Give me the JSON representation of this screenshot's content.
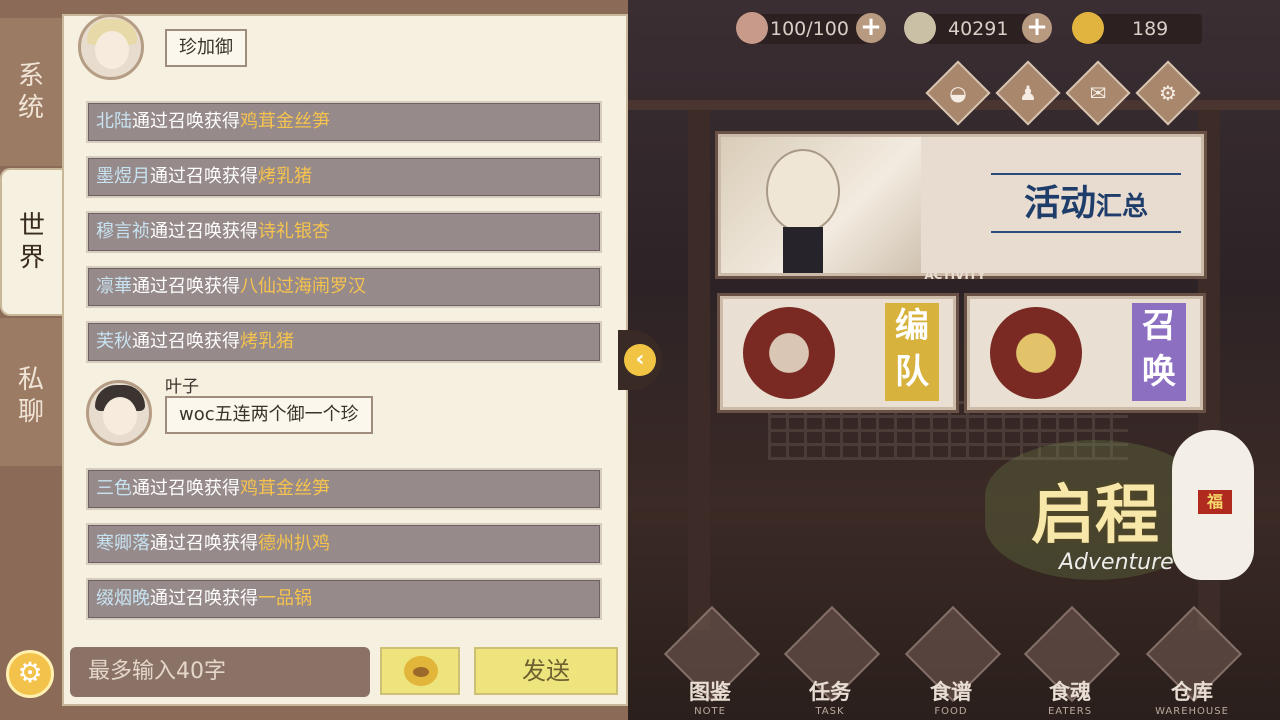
{
  "resources": {
    "stamina": "100/100",
    "coins": "40291",
    "gems": "189"
  },
  "tabs": [
    {
      "label_top": "系",
      "label_bottom": "统"
    },
    {
      "label_top": "世",
      "label_bottom": "界"
    },
    {
      "label_top": "私",
      "label_bottom": "聊"
    }
  ],
  "chat": {
    "first_bubble": "珍加御",
    "messages": [
      {
        "name": "北陆",
        "verb": "通过召唤获得",
        "item": "鸡茸金丝笋"
      },
      {
        "name": "墨煜月",
        "verb": "通过召唤获得",
        "item": "烤乳猪"
      },
      {
        "name": "穆言祯",
        "verb": "通过召唤获得",
        "item": "诗礼银杏"
      },
      {
        "name": "凛華",
        "verb": "通过召唤获得",
        "item": "八仙过海闹罗汉"
      },
      {
        "name": "芙秋",
        "verb": "通过召唤获得",
        "item": "烤乳猪"
      },
      {
        "name": "三色",
        "verb": "通过召唤获得",
        "item": "鸡茸金丝笋"
      },
      {
        "name": "寒卿落",
        "verb": "通过召唤获得",
        "item": "德州扒鸡"
      },
      {
        "name": "缀烟晚",
        "verb": "通过召唤获得",
        "item": "一品锅"
      }
    ],
    "user_msg": {
      "name": "叶子",
      "text": "woc五连两个御一个珍"
    },
    "input_placeholder": "最多输入40字",
    "send_label": "发送"
  },
  "banner": {
    "title_big": "活动",
    "title_small": "汇总",
    "label": "ACTIVITY"
  },
  "cards": [
    {
      "label": "编队"
    },
    {
      "label": "召唤"
    }
  ],
  "adventure": {
    "cn": "启程",
    "en": "Adventure",
    "tag": "福"
  },
  "bottom_nav": [
    {
      "cn": "图鉴",
      "en": "NOTE"
    },
    {
      "cn": "任务",
      "en": "TASK"
    },
    {
      "cn": "食谱",
      "en": "FOOD"
    },
    {
      "cn": "食魂",
      "en": "EATERS"
    },
    {
      "cn": "仓库",
      "en": "WAREHOUSE"
    }
  ]
}
